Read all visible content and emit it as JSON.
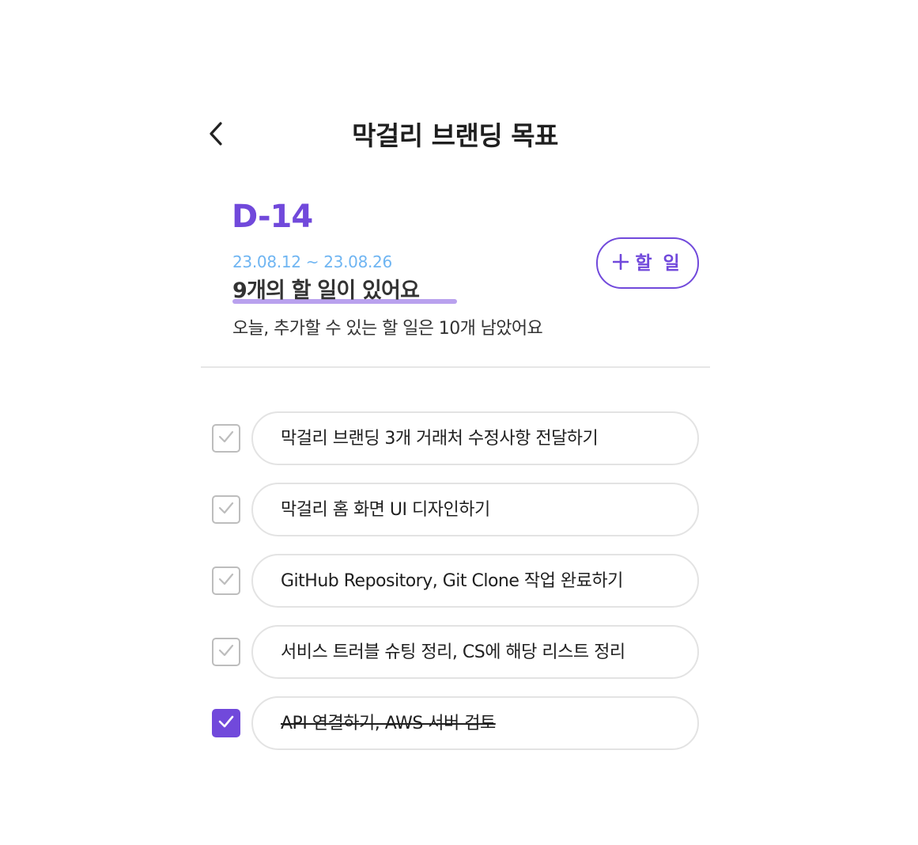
{
  "header": {
    "title": "막걸리 브랜딩 목표",
    "back_icon": "chevron-left-icon"
  },
  "goal": {
    "dday": "D-14",
    "date_range": "23.08.12 ~ 23.08.26",
    "task_count_text": "9개의 할 일이 있어요",
    "remaining_text": "오늘, 추가할 수 있는 할 일은 10개 남았어요"
  },
  "add_button": {
    "icon": "plus-icon",
    "label": "할 일"
  },
  "colors": {
    "accent": "#7149db",
    "accent_light": "#b9a1ee",
    "date": "#6fb5f2",
    "border": "#e3e3e3",
    "checkbox_border": "#bdbdbd"
  },
  "todos": [
    {
      "text": "막걸리 브랜딩 3개 거래처 수정사항 전달하기",
      "checked": false
    },
    {
      "text": "막걸리 홈 화면 UI 디자인하기",
      "checked": false
    },
    {
      "text": "GitHub Repository, Git Clone 작업 완료하기",
      "checked": false
    },
    {
      "text": "서비스 트러블 슈팅 정리, CS에 해당 리스트 정리",
      "checked": false
    },
    {
      "text": "API 연결하기, AWS 서버 검토",
      "checked": true
    }
  ]
}
